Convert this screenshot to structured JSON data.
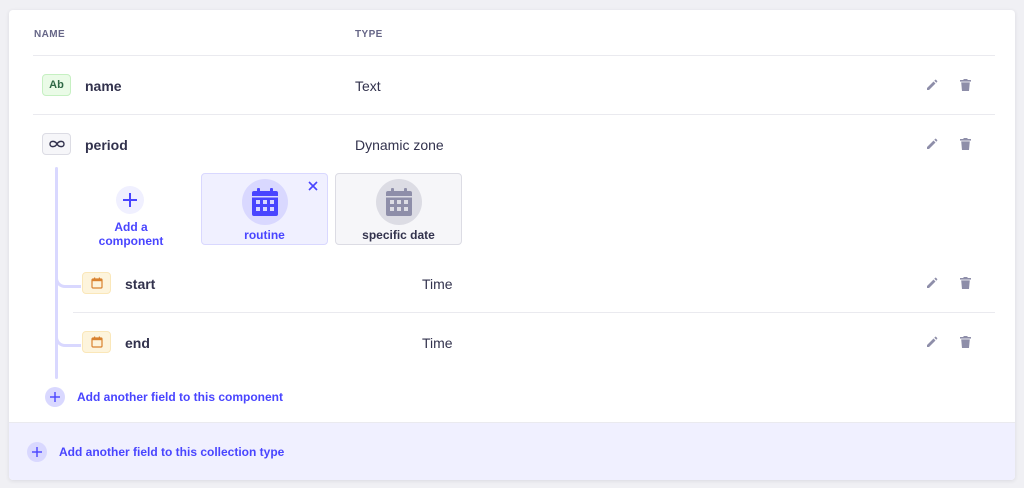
{
  "table": {
    "headers": {
      "name": "NAME",
      "type": "TYPE"
    }
  },
  "fields": [
    {
      "badge": "Ab",
      "badge_icon": "text-type-icon",
      "name": "name",
      "type": "Text"
    },
    {
      "badge_icon": "infinity-icon",
      "name": "period",
      "type": "Dynamic zone"
    }
  ],
  "dynamic_zone": {
    "add_component_label": "Add a component",
    "components": [
      {
        "label": "routine",
        "icon": "calendar-icon",
        "active": true
      },
      {
        "label": "specific date",
        "icon": "calendar-icon",
        "active": false
      }
    ],
    "component_fields": [
      {
        "badge_icon": "date-icon",
        "name": "start",
        "type": "Time"
      },
      {
        "badge_icon": "date-icon",
        "name": "end",
        "type": "Time"
      }
    ],
    "add_field_label": "Add another field to this component"
  },
  "footer": {
    "add_field_label": "Add another field to this collection type"
  },
  "icons": {
    "edit": "pencil-icon",
    "delete": "trash-icon"
  },
  "colors": {
    "primary": "#4945ff",
    "primary_light": "#f0f0ff",
    "text": "#32324d",
    "muted": "#666687",
    "text_badge_bg": "#eafbe7",
    "date_badge_bg": "#fdf4dc"
  }
}
